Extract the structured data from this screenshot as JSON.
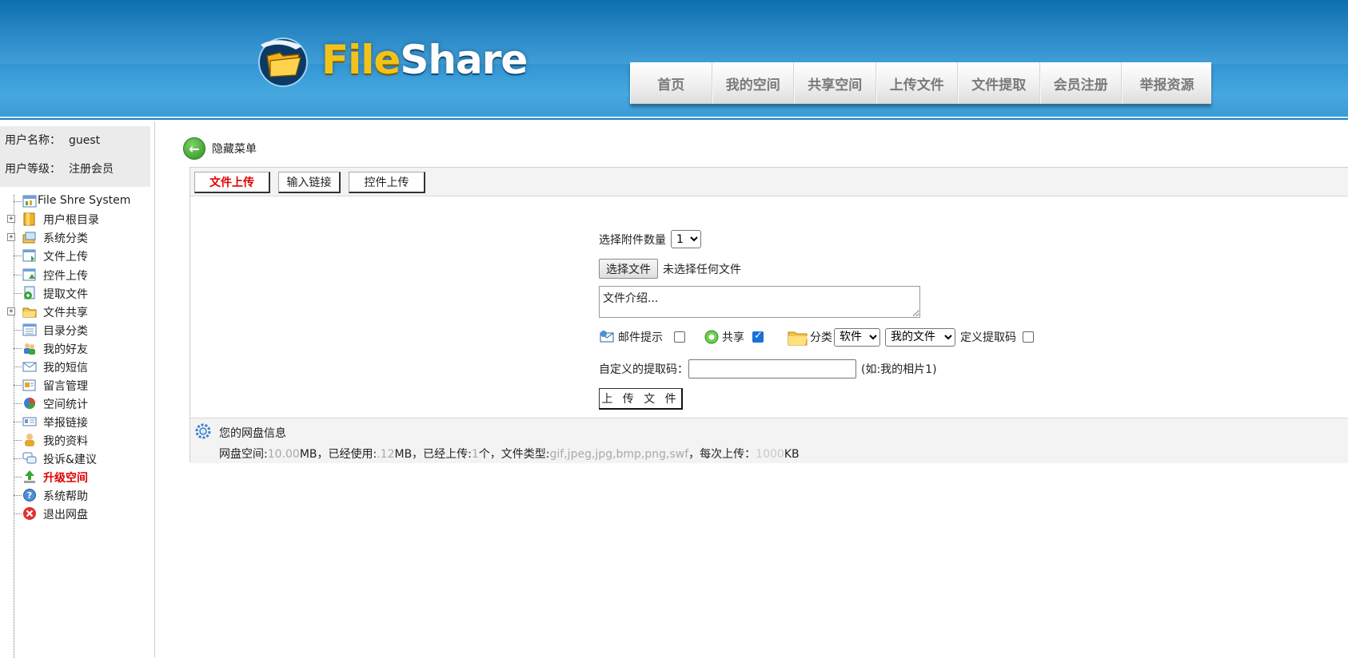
{
  "header": {
    "logo_file": "File",
    "logo_share": "Share",
    "nav": [
      "首页",
      "我的空间",
      "共享空间",
      "上传文件",
      "文件提取",
      "会员注册",
      "举报资源"
    ]
  },
  "user": {
    "name_label": "用户名称：",
    "name_value": "guest",
    "level_label": "用户等级：",
    "level_value": "注册会员"
  },
  "tree": {
    "root": "File Shre System",
    "items": [
      "用户根目录",
      "系统分类",
      "文件上传",
      "控件上传",
      "提取文件",
      "文件共享",
      "目录分类",
      "我的好友",
      "我的短信",
      "留言管理",
      "空间统计",
      "举报链接",
      "我的资料",
      "投诉&建议",
      "升级空间",
      "系统帮助",
      "退出网盘"
    ]
  },
  "main": {
    "hide_menu": "隐藏菜单",
    "tabs": [
      "文件上传",
      "输入链接",
      "控件上传"
    ],
    "form": {
      "attach_count_label": "选择附件数量",
      "attach_count_value": "1",
      "choose_file_button": "选择文件",
      "no_file_text": "未选择任何文件",
      "description_value": "文件介绍...",
      "email_label": "邮件提示",
      "share_label": "共享",
      "category_label": "分类",
      "category_select": "软件",
      "folder_select": "我的文件",
      "custom_code_checkbox_label": "定义提取码",
      "custom_code_label": "自定义的提取码：",
      "custom_code_hint": "(如:我的相片1)",
      "upload_button": "上 传 文 件"
    },
    "info": {
      "title": "您的网盘信息",
      "space_label": "网盘空间:",
      "space_value": "10.00",
      "space_unit": "MB，已经使用:",
      "used_value": ".12",
      "used_unit": "MB，已经上传:",
      "uploaded_value": "1",
      "uploaded_unit": "个，文件类型:",
      "types_value": "gif,jpeg,jpg,bmp,png,swf",
      "per_label": "，每次上传：",
      "per_value": "1000",
      "per_unit": "KB"
    }
  },
  "colors": {
    "header_blue": "#2b8fcf",
    "accent_red": "#e00000",
    "nav_text": "#7a7a7a"
  }
}
